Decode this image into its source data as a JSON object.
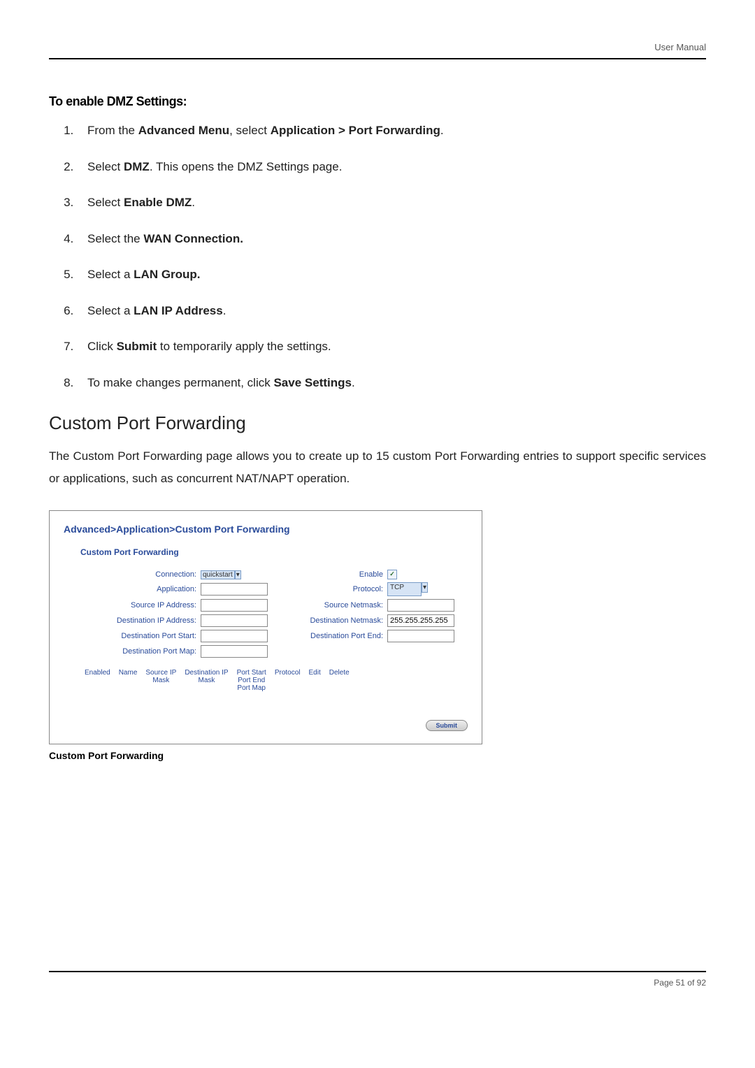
{
  "header": {
    "label": "User Manual"
  },
  "section": {
    "title": "To enable DMZ Settings:"
  },
  "steps": [
    {
      "prefix": "From the ",
      "b1": "Advanced Menu",
      "mid": ", select ",
      "b2": "Application > Port Forwarding",
      "suffix": "."
    },
    {
      "prefix": "Select ",
      "b1": "DMZ",
      "mid": ". This opens the DMZ Settings page.",
      "b2": "",
      "suffix": ""
    },
    {
      "prefix": "Select ",
      "b1": "Enable DMZ",
      "mid": ".",
      "b2": "",
      "suffix": ""
    },
    {
      "prefix": "Select the ",
      "b1": "WAN Connection.",
      "mid": "",
      "b2": "",
      "suffix": ""
    },
    {
      "prefix": "Select a ",
      "b1": "LAN Group.",
      "mid": "",
      "b2": "",
      "suffix": ""
    },
    {
      "prefix": "Select a ",
      "b1": "LAN IP Address",
      "mid": ".",
      "b2": "",
      "suffix": ""
    },
    {
      "prefix": "Click ",
      "b1": "Submit",
      "mid": " to temporarily apply the settings.",
      "b2": "",
      "suffix": ""
    },
    {
      "prefix": "To make changes permanent, click ",
      "b1": "Save Settings",
      "mid": ".",
      "b2": "",
      "suffix": ""
    }
  ],
  "custom": {
    "heading": "Custom Port Forwarding",
    "body": "The Custom Port Forwarding page allows you to create up to 15 custom Port Forwarding entries to support specific services or applications, such as concurrent NAT/NAPT operation."
  },
  "figure": {
    "breadcrumb": "Advanced>Application>Custom Port Forwarding",
    "panel_title": "Custom Port Forwarding",
    "form": {
      "connection_label": "Connection:",
      "connection_value": "quickstart",
      "enable_label": "Enable",
      "application_label": "Application:",
      "protocol_label": "Protocol:",
      "protocol_value": "TCP",
      "source_ip_label": "Source IP Address:",
      "source_netmask_label": "Source Netmask:",
      "dest_ip_label": "Destination IP Address:",
      "dest_netmask_label": "Destination Netmask:",
      "dest_netmask_value": "255.255.255.255",
      "port_start_label": "Destination Port Start:",
      "port_end_label": "Destination Port End:",
      "port_map_label": "Destination Port Map:"
    },
    "table_headers": {
      "enabled": "Enabled",
      "name": "Name",
      "source": "Source IP\nMask",
      "dest": "Destination IP\nMask",
      "port": "Port Start\nPort End\nPort Map",
      "protocol": "Protocol",
      "edit": "Edit",
      "delete": "Delete"
    },
    "submit": "Submit",
    "caption": "Custom Port Forwarding"
  },
  "footer": {
    "page": "Page 51 of 92"
  }
}
